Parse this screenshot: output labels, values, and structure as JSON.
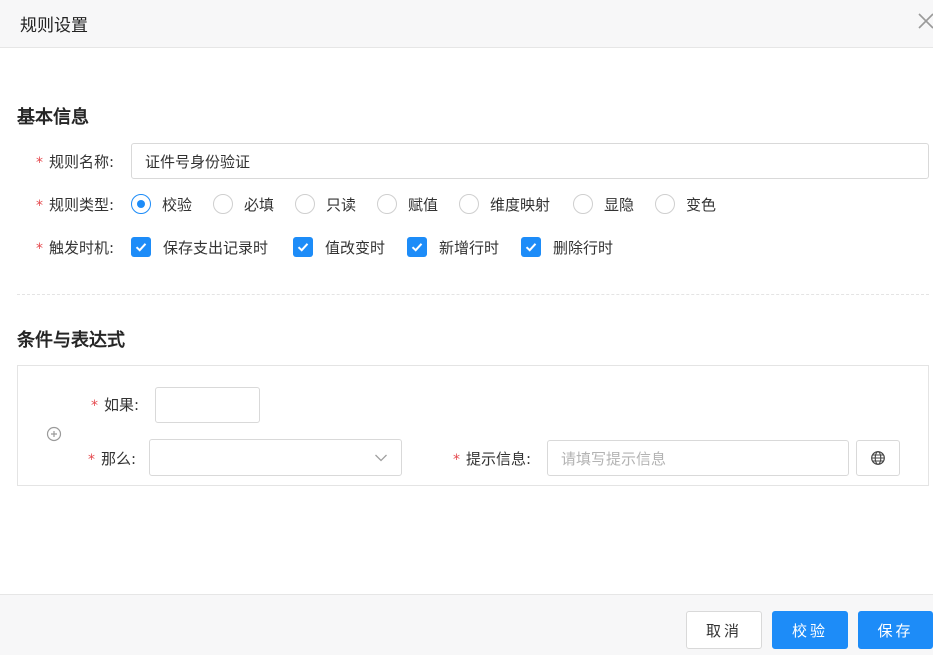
{
  "dialog": {
    "title": "规则设置",
    "close_icon": "close-icon"
  },
  "basic_info": {
    "section_title": "基本信息",
    "rule_name": {
      "label": "规则名称:",
      "value": "证件号身份验证"
    },
    "rule_type": {
      "label": "规则类型:",
      "options": [
        "校验",
        "必填",
        "只读",
        "赋值",
        "维度映射",
        "显隐",
        "变色"
      ],
      "selected": "校验"
    },
    "trigger": {
      "label": "触发时机:",
      "options": [
        "保存支出记录时",
        "值改变时",
        "新增行时",
        "删除行时"
      ],
      "checked": [
        true,
        true,
        true,
        true
      ]
    }
  },
  "conditions": {
    "section_title": "条件与表达式",
    "add_icon": "add-circle-icon",
    "if_label": "如果:",
    "if_value": "",
    "then_label": "那么:",
    "then_value": "",
    "prompt_label": "提示信息:",
    "prompt_placeholder": "请填写提示信息",
    "globe_icon": "globe-icon"
  },
  "footer": {
    "cancel_label": "取消",
    "validate_label": "校验",
    "save_label": "保存"
  },
  "colors": {
    "accent": "#1d8cf8",
    "required": "#e5484d"
  }
}
